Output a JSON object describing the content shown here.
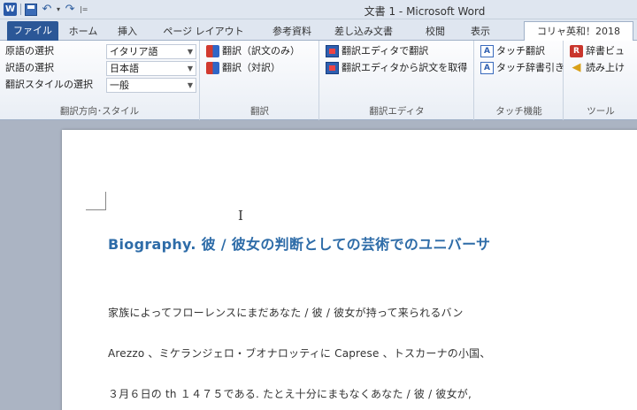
{
  "window": {
    "title": "文書 1 - Microsoft Word"
  },
  "quick_access": {
    "app_icon_label": "W",
    "undo_symbol": "↶",
    "redo_symbol": "↷",
    "dropdown_symbol": "▾",
    "customize_symbol": "|="
  },
  "tabs": [
    {
      "label": "ファイル"
    },
    {
      "label": "ホーム"
    },
    {
      "label": "挿入"
    },
    {
      "label": "ページ レイアウト"
    },
    {
      "label": "参考資料"
    },
    {
      "label": "差し込み文書"
    },
    {
      "label": "校閲"
    },
    {
      "label": "表示"
    },
    {
      "label": "コリャ英和！2018"
    }
  ],
  "ribbon": {
    "groups": {
      "direction": {
        "label": "翻訳方向･スタイル",
        "source_label": "原語の選択",
        "source_value": "イタリア語",
        "target_label": "訳語の選択",
        "target_value": "日本語",
        "style_label": "翻訳スタイルの選択",
        "style_value": "一般"
      },
      "translate": {
        "label": "翻訳",
        "btn_only": "翻訳（訳文のみ）",
        "btn_parallel": "翻訳（対訳）"
      },
      "editor": {
        "label": "翻訳エディタ",
        "btn_translate": "翻訳エディタで翻訳",
        "btn_fetch": "翻訳エディタから訳文を取得"
      },
      "touch": {
        "label": "タッチ機能",
        "btn_touch": "タッチ翻訳",
        "btn_dict": "タッチ辞書引き"
      },
      "tools": {
        "label": "ツール",
        "btn_viewer": "辞書ビュ",
        "btn_read": "読み上け"
      }
    }
  },
  "document": {
    "heading": "Biography. 彼 / 彼女の判断としての芸術でのユニバーサ",
    "paragraphs": [
      "家族によってフローレンスにまだあなた / 彼 / 彼女が持って来られるバン",
      "Arezzo 、ミケランジェロ・ブオナロッティに Caprese 、トスカーナの小国、",
      "３月６日の th １４７５である. たとえ十分にまもなくあなた / 彼 / 彼女が,"
    ]
  },
  "colors": {
    "accent": "#2b5797",
    "heading": "#2e6ca8"
  }
}
